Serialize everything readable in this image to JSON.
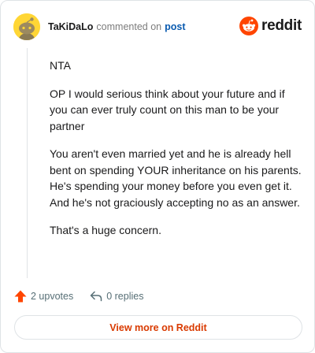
{
  "header": {
    "username": "TaKiDaLo",
    "commented_on": "commented on",
    "post_link": "post",
    "brand": "reddit"
  },
  "comment": {
    "paragraphs": [
      "NTA",
      "OP I would serious think about your future and if you can ever truly count on this man to be your partner",
      "You aren't even married yet and he is already hell bent on spending YOUR inheritance on his parents. He's spending your money before you even get it. And he's not graciously accepting no as an answer.",
      "That's a huge concern."
    ]
  },
  "actions": {
    "upvotes": "2 upvotes",
    "replies": "0 replies"
  },
  "footer": {
    "view_more": "View more on Reddit"
  },
  "colors": {
    "brand_orange": "#ff4500",
    "link_blue": "#0a5bb0",
    "view_more": "#d93a00"
  },
  "icons": {
    "avatar": "snoo-avatar",
    "brand": "reddit-logo-icon",
    "upvote": "upvote-arrow-icon",
    "reply": "reply-arrow-icon"
  }
}
